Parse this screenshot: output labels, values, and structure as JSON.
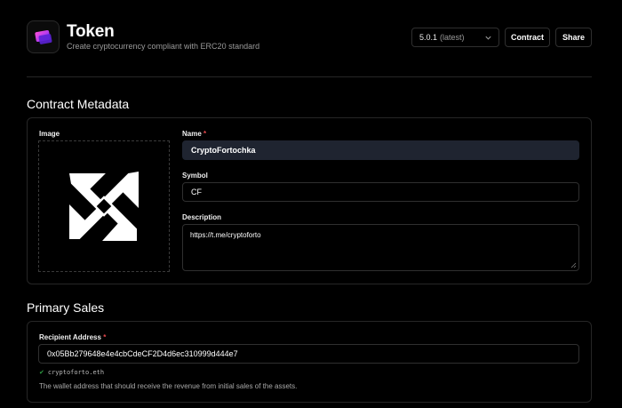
{
  "header": {
    "title": "Token",
    "subtitle": "Create cryptocurrency compliant with ERC20 standard",
    "version": {
      "value": "5.0.1",
      "suffix": "(latest)"
    },
    "contract_label": "Contract",
    "share_label": "Share"
  },
  "metadata": {
    "title": "Contract Metadata",
    "image_label": "Image",
    "name_label": "Name",
    "name_value": "CryptoFortochka",
    "symbol_label": "Symbol",
    "symbol_value": "CF",
    "description_label": "Description",
    "description_value": "https://t.me/cryptoforto"
  },
  "sales": {
    "title": "Primary Sales",
    "recipient_label": "Recipient Address",
    "recipient_value": "0x05Bb279648e4e4cbCdeCF2D4d6ec310999d444e7",
    "ens_name": "cryptoforto.eth",
    "helper_text": "The wallet address that should receive the revenue from initial sales of the assets."
  },
  "required_marker": "*",
  "colors": {
    "background": "#000000",
    "required": "#e5484d",
    "filled_input": "#1f2430",
    "check": "#2f9e44"
  }
}
